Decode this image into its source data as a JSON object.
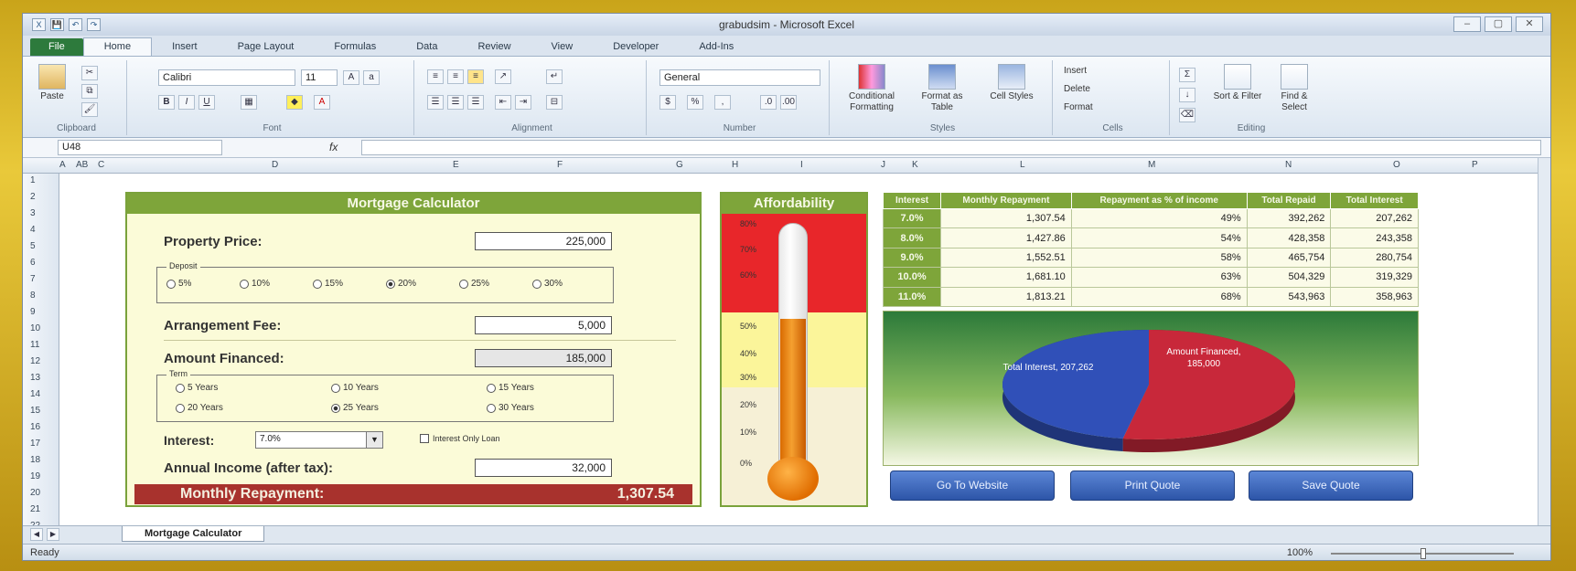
{
  "window": {
    "title": "grabudsim - Microsoft Excel",
    "controls": [
      "–",
      "▢",
      "✕"
    ]
  },
  "qat": [
    "X",
    "💾",
    "↶",
    "↷"
  ],
  "tabs": [
    "File",
    "Home",
    "Insert",
    "Page Layout",
    "Formulas",
    "Data",
    "Review",
    "View",
    "Developer",
    "Add-Ins"
  ],
  "ribbon": {
    "paste": "Paste",
    "clipboard": "Clipboard",
    "font_name": "Calibri",
    "font_size": "11",
    "font": "Font",
    "alignment": "Alignment",
    "number_format": "General",
    "number": "Number",
    "conditional": "Conditional Formatting",
    "format_table": "Format as Table",
    "cell_styles": "Cell Styles",
    "styles": "Styles",
    "insert": "Insert",
    "delete": "Delete",
    "format": "Format",
    "cells": "Cells",
    "sort": "Sort & Filter",
    "find": "Find & Select",
    "editing": "Editing"
  },
  "formula_bar": {
    "name_box": "U48",
    "fx": "fx",
    "value": ""
  },
  "columns": [
    "A",
    "AB",
    "C",
    "D",
    "E",
    "F",
    "G",
    "H",
    "I",
    "J",
    "K",
    "L",
    "M",
    "N",
    "O",
    "P"
  ],
  "rows": [
    "1",
    "2",
    "3",
    "4",
    "5",
    "6",
    "7",
    "8",
    "9",
    "10",
    "11",
    "12",
    "13",
    "14",
    "15",
    "16",
    "17",
    "18",
    "19",
    "20",
    "21",
    "22"
  ],
  "calculator": {
    "title": "Mortgage Calculator",
    "property_label": "Property Price:",
    "property_value": "225,000",
    "deposit_legend": "Deposit",
    "deposit_options": [
      "5%",
      "10%",
      "15%",
      "20%",
      "25%",
      "30%"
    ],
    "deposit_selected": "20%",
    "fee_label": "Arrangement Fee:",
    "fee_value": "5,000",
    "financed_label": "Amount Financed:",
    "financed_value": "185,000",
    "term_legend": "Term",
    "term_options": [
      "5 Years",
      "10 Years",
      "15 Years",
      "20 Years",
      "25 Years",
      "30 Years"
    ],
    "term_selected": "25 Years",
    "interest_label": "Interest:",
    "interest_value": "7.0%",
    "interest_only_label": "Interest Only Loan",
    "income_label": "Annual Income (after tax):",
    "income_value": "32,000",
    "monthly_label": "Monthly Repayment:",
    "monthly_value": "1,307.54"
  },
  "affordability": {
    "title": "Affordability",
    "ticks": [
      "80%",
      "70%",
      "60%",
      "50%",
      "40%",
      "30%",
      "20%",
      "10%",
      "0%"
    ],
    "level_percent": 49,
    "colors": {
      "red": "#e8262a",
      "yellow": "#fbf59a",
      "beige": "#f6f0d6",
      "mercury": "#f08a1c"
    }
  },
  "table": {
    "headers": [
      "Interest",
      "Monthly Repayment",
      "Repayment as % of income",
      "Total Repaid",
      "Total Interest"
    ],
    "rows": [
      [
        "7.0%",
        "1,307.54",
        "49%",
        "392,262",
        "207,262"
      ],
      [
        "8.0%",
        "1,427.86",
        "54%",
        "428,358",
        "243,358"
      ],
      [
        "9.0%",
        "1,552.51",
        "58%",
        "465,754",
        "280,754"
      ],
      [
        "10.0%",
        "1,681.10",
        "63%",
        "504,329",
        "319,329"
      ],
      [
        "11.0%",
        "1,813.21",
        "68%",
        "543,963",
        "358,963"
      ]
    ]
  },
  "chart_data": {
    "type": "pie",
    "categories": [
      "Total Interest",
      "Amount Financed"
    ],
    "values": [
      207262,
      185000
    ],
    "labels": [
      "Total Interest, 207,262",
      "Amount Financed, 185,000"
    ],
    "colors": [
      "#c8283a",
      "#3050b8"
    ]
  },
  "buttons": {
    "website": "Go To Website",
    "print": "Print Quote",
    "save": "Save Quote"
  },
  "sheet_tab": "Mortgage Calculator",
  "status": {
    "ready": "Ready",
    "zoom": "100%"
  }
}
